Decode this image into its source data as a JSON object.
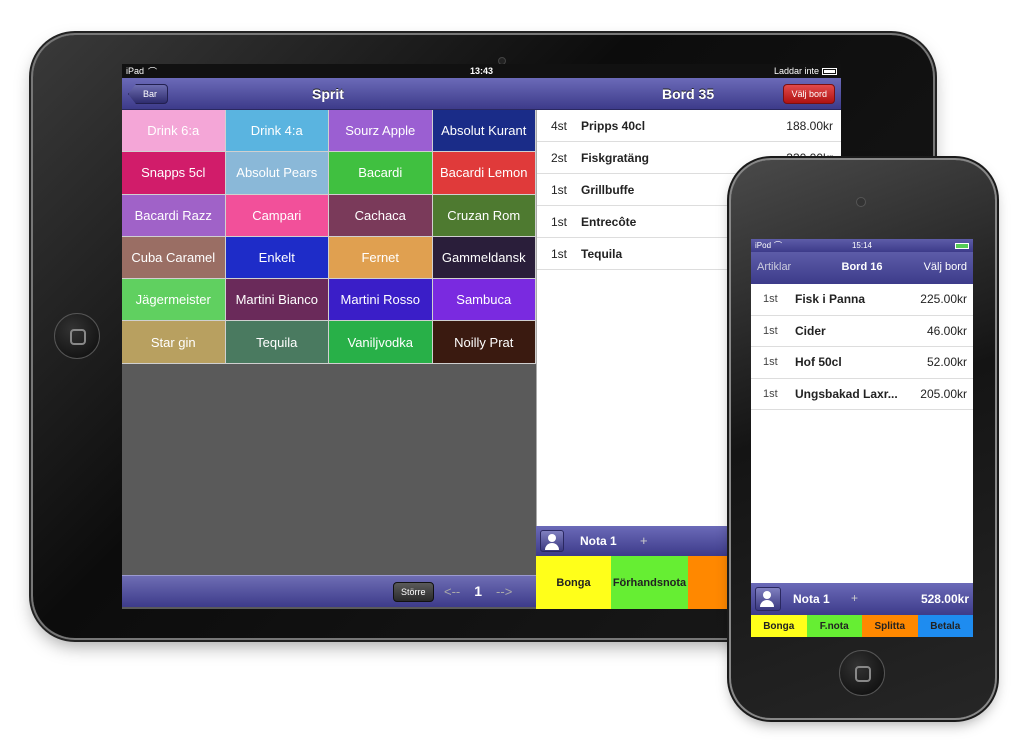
{
  "ipad": {
    "status": {
      "device": "iPad",
      "time": "13:43",
      "charging": "Laddar inte"
    },
    "nav": {
      "back_label": "Bar",
      "category_title": "Sprit",
      "table_title": "Bord 35",
      "select_table_label": "Välj bord"
    },
    "products": [
      {
        "label": "Drink 6:a",
        "color": "#f4a6d7"
      },
      {
        "label": "Drink 4:a",
        "color": "#5ab4e0"
      },
      {
        "label": "Sourz Apple",
        "color": "#9b5fd2"
      },
      {
        "label": "Absolut Kurant",
        "color": "#1a2c88"
      },
      {
        "label": "Snapps 5cl",
        "color": "#d11c6a"
      },
      {
        "label": "Absolut Pears",
        "color": "#8ab8d8"
      },
      {
        "label": "Bacardi",
        "color": "#40c040"
      },
      {
        "label": "Bacardi Lemon",
        "color": "#e03a3a"
      },
      {
        "label": "Bacardi Razz",
        "color": "#a062c8"
      },
      {
        "label": "Campari",
        "color": "#f2509a"
      },
      {
        "label": "Cachaca",
        "color": "#7a3a5a"
      },
      {
        "label": "Cruzan Rom",
        "color": "#4e7a30"
      },
      {
        "label": "Cuba Caramel",
        "color": "#9a6e64"
      },
      {
        "label": "Enkelt",
        "color": "#1e2cc8"
      },
      {
        "label": "Fernet",
        "color": "#e0a050"
      },
      {
        "label": "Gammeldansk",
        "color": "#2a1e3a"
      },
      {
        "label": "Jägermeister",
        "color": "#60d060"
      },
      {
        "label": "Martini Bianco",
        "color": "#6a2a5a"
      },
      {
        "label": "Martini Rosso",
        "color": "#3a1ec8"
      },
      {
        "label": "Sambuca",
        "color": "#7a2ae0"
      },
      {
        "label": "Star gin",
        "color": "#b8a060"
      },
      {
        "label": "Tequila",
        "color": "#4a7a60"
      },
      {
        "label": "Vaniljvodka",
        "color": "#28b048"
      },
      {
        "label": "Noilly Prat",
        "color": "#3a1a10"
      }
    ],
    "toolbar": {
      "larger_label": "Större",
      "prev_arrow": "<--",
      "page": "1",
      "next_arrow": "-->"
    },
    "order": [
      {
        "qty": "4st",
        "name": "Pripps 40cl",
        "price": "188.00kr"
      },
      {
        "qty": "2st",
        "name": "Fiskgratäng",
        "price": "330.00kr"
      },
      {
        "qty": "1st",
        "name": "Grillbuffe",
        "price": ""
      },
      {
        "qty": "1st",
        "name": "Entrecôte",
        "price": ""
      },
      {
        "qty": "1st",
        "name": "Tequila",
        "price": ""
      }
    ],
    "nota": {
      "label": "Nota 1",
      "plus": "+"
    },
    "actions": [
      {
        "label": "Bonga",
        "color": "#ffff1a"
      },
      {
        "label": "Förhandsnota",
        "color": "#66ee33"
      },
      {
        "label": "Split",
        "color": "#ff8800"
      }
    ]
  },
  "ipod": {
    "status": {
      "device": "iPod",
      "time": "15:14"
    },
    "nav": {
      "back_label": "Artiklar",
      "table_title": "Bord 16",
      "select_table_label": "Välj bord"
    },
    "order": [
      {
        "qty": "1st",
        "name": "Fisk i Panna",
        "price": "225.00kr"
      },
      {
        "qty": "1st",
        "name": "Cider",
        "price": "46.00kr"
      },
      {
        "qty": "1st",
        "name": "Hof 50cl",
        "price": "52.00kr"
      },
      {
        "qty": "1st",
        "name": "Ungsbakad Laxr...",
        "price": "205.00kr"
      }
    ],
    "nota": {
      "label": "Nota 1",
      "plus": "+",
      "total": "528.00kr"
    },
    "actions": [
      {
        "label": "Bonga",
        "color": "#ffff1a"
      },
      {
        "label": "F.nota",
        "color": "#66ee33"
      },
      {
        "label": "Splitta",
        "color": "#ff8800"
      },
      {
        "label": "Betala",
        "color": "#1e8cf0"
      }
    ]
  }
}
